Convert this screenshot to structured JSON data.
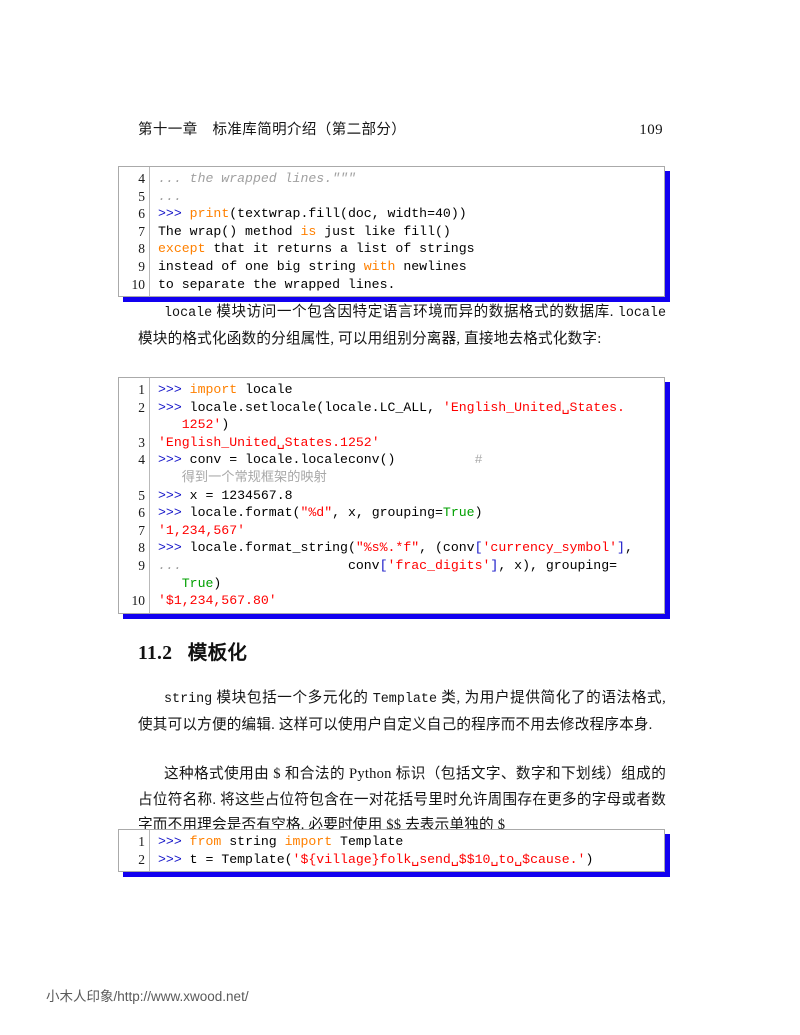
{
  "header": {
    "chapter": "第十一章　标准库简明介绍（第二部分）",
    "page_number": "109"
  },
  "listing1": {
    "line_numbers": [
      "4",
      "5",
      "6",
      "7",
      "8",
      "9",
      "10"
    ],
    "lines": [
      "... the wrapped lines.\"\"\"",
      "...",
      ">>> print(textwrap.fill(doc, width=40))",
      "The wrap() method is just like fill()",
      "except that it returns a list of strings",
      "instead of one big string with newlines",
      "to separate the wrapped lines."
    ]
  },
  "paragraph1": "locale 模块访问一个包含因特定语言环境而异的数据格式的数据库. locale 模块的格式化函数的分组属性, 可以用组别分离器, 直接地去格式化数字:",
  "listing2": {
    "line_numbers": [
      "1",
      "2",
      "3",
      "4",
      "5",
      "6",
      "7",
      "8",
      "9",
      "10"
    ],
    "lines": [
      ">>> import locale",
      ">>> locale.setlocale(locale.LC_ALL, 'English_United␣States.1252')",
      "'English_United␣States.1252'",
      ">>> conv = locale.localeconv()            # 得到一个常规框架的映射",
      ">>> x = 1234567.8",
      ">>> locale.format(\"%d\", x, grouping=True)",
      "'1,234,567'",
      ">>> locale.format_string(\"%s%.*f\", (conv['currency_symbol'],",
      "...                      conv['frac_digits'], x), grouping=True)",
      "'$1,234,567.80'"
    ]
  },
  "section": {
    "number": "11.2",
    "title": "模板化"
  },
  "paragraph2": "string 模块包括一个多元化的 Template 类, 为用户提供简化了的语法格式, 使其可以方便的编辑. 这样可以使用户自定义自己的程序而不用去修改程序本身.",
  "paragraph3": "这种格式使用由 $ 和合法的 Python 标识（包括文字、数字和下划线）组成的占位符名称. 将这些占位符包含在一对花括号里时允许周围存在更多的字母或者数字而不用理会是否有空格. 必要时使用 $$ 去表示单独的 $",
  "listing3": {
    "line_numbers": [
      "1",
      "2"
    ],
    "lines": [
      ">>> from string import Template",
      ">>> t = Template('${village}folk␣send␣$$10␣to␣$cause.')"
    ]
  },
  "watermark": "小木人印象/http://www.xwood.net/",
  "colors": {
    "keyword": "#ff8000",
    "string": "#ff0000",
    "constant": "#00a000",
    "prompt": "#1414c8",
    "comment": "#a0a0a0",
    "shadow": "#1200f0",
    "border": "#aaaaaa"
  }
}
